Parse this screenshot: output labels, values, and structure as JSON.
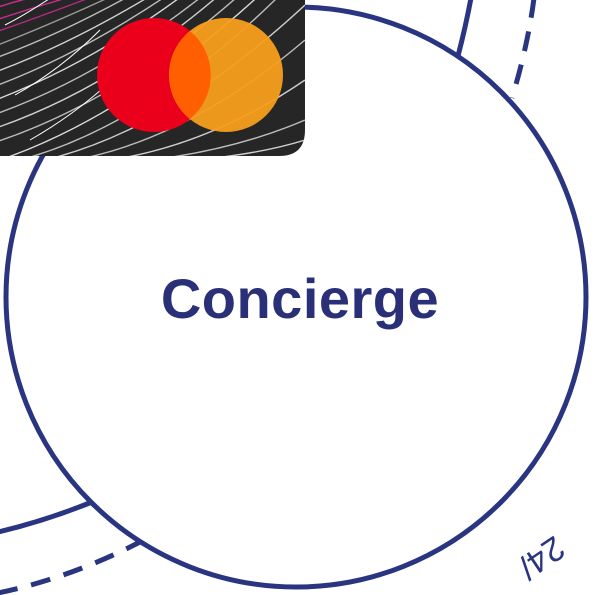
{
  "center_label": "Concierge",
  "partial_text": "24/",
  "colors": {
    "ring": "#2a3582",
    "label": "#2a3078",
    "card": "#2b2b2b",
    "mastercard_red": "#eb001b",
    "mastercard_orange": "#f79e1b",
    "mastercard_overlap": "#ff5f00"
  },
  "icons": {
    "card": "credit-card",
    "logo": "mastercard-logo"
  }
}
